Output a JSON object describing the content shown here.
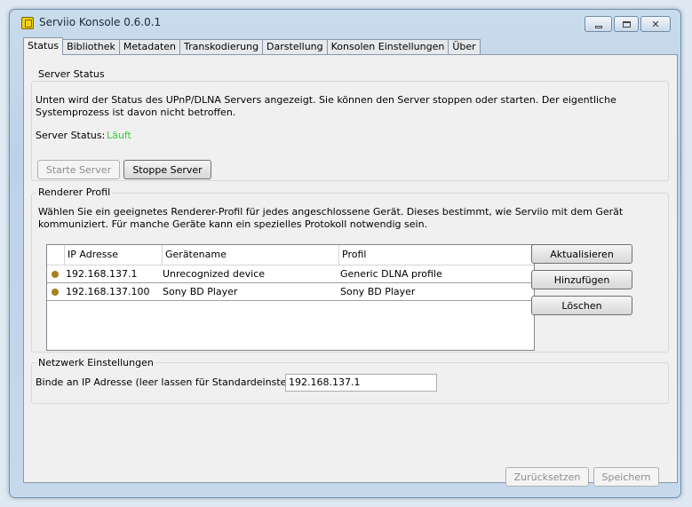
{
  "window": {
    "title": "Serviio Konsole 0.6.0.1"
  },
  "tabs": [
    "Status",
    "Bibliothek",
    "Metadaten",
    "Transkodierung",
    "Darstellung",
    "Konsolen Einstellungen",
    "Über"
  ],
  "server_status": {
    "group_title": "Server Status",
    "description": "Unten wird der Status des UPnP/DLNA Servers angezeigt. Sie können den Server stoppen oder starten. Der eigentliche Systemprozess ist davon nicht betroffen.",
    "status_label": "Server Status:",
    "status_value": "Läuft",
    "status_color": "#33cc33",
    "start_button": "Starte Server",
    "stop_button": "Stoppe Server"
  },
  "renderer_profile": {
    "group_title": "Renderer Profil",
    "description": "Wählen Sie ein geeignetes Renderer-Profil für jedes angeschlossene Gerät. Dieses bestimmt, wie Serviio mit dem Gerät kommuniziert. Für manche Geräte kann ein spezielles Protokoll notwendig sein.",
    "columns": [
      "IP Adresse",
      "Gerätename",
      "Profil"
    ],
    "rows": [
      {
        "ip": "192.168.137.1",
        "device": "Unrecognized device",
        "profile": "Generic DLNA profile"
      },
      {
        "ip": "192.168.137.100",
        "device": "Sony BD Player",
        "profile": "Sony BD Player"
      }
    ],
    "refresh_button": "Aktualisieren",
    "add_button": "Hinzufügen",
    "delete_button": "Löschen"
  },
  "network": {
    "group_title": "Netzwerk Einstellungen",
    "bind_label": "Binde an IP Adresse (leer lassen für Standardeinstellung):",
    "bind_value": "192.168.137.1"
  },
  "footer": {
    "reset_button": "Zurücksetzen",
    "save_button": "Speichern"
  }
}
